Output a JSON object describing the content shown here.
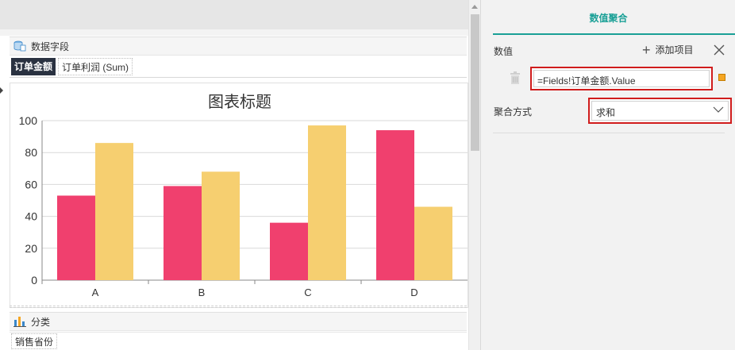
{
  "data_zone": {
    "icon": "database-icon",
    "label": "数据字段"
  },
  "value_fields": [
    {
      "label": "订单金额",
      "active": true
    },
    {
      "label": "订单利润 (Sum)",
      "active": false
    }
  ],
  "chart_data": {
    "type": "bar",
    "title": "图表标题",
    "categories": [
      "A",
      "B",
      "C",
      "D"
    ],
    "series": [
      {
        "values": [
          53,
          59,
          36,
          94
        ],
        "color": "#f0406e"
      },
      {
        "values": [
          86,
          68,
          97,
          46
        ],
        "color": "#f6cf70"
      }
    ],
    "ylim": [
      0,
      100
    ],
    "yticks": [
      "0",
      "20",
      "40",
      "60",
      "80",
      "100"
    ],
    "grid": true
  },
  "category_zone": {
    "icon": "bar-chart-icon",
    "label": "分类"
  },
  "category_fields": [
    {
      "label": "销售省份"
    }
  ],
  "panel": {
    "tab_label": "数值聚合",
    "value_label": "数值",
    "add_item_label": "添加项目",
    "expression": "=Fields!订单金额.Value",
    "aggregation_label": "聚合方式",
    "aggregation_value": "求和",
    "accent_color": "#1aa096",
    "highlight_color": "#d01c1c"
  }
}
